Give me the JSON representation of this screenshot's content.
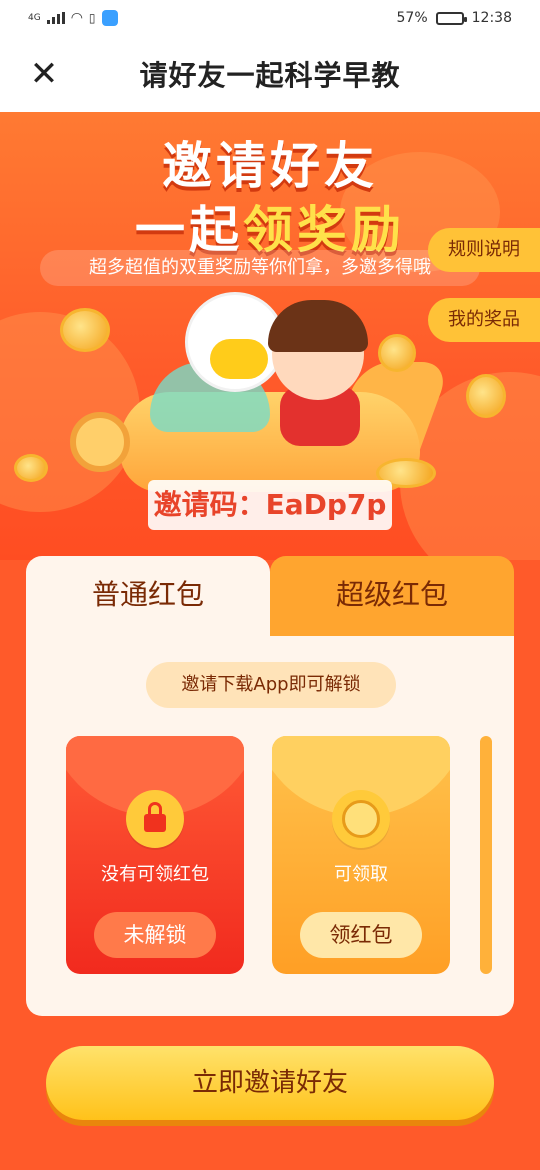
{
  "status_bar": {
    "network": "4G",
    "battery_percent": "57%",
    "battery_level": 0.57,
    "time": "12:38"
  },
  "header": {
    "close_icon": "close-icon",
    "title": "请好友一起科学早教"
  },
  "hero": {
    "title_line1": "邀请好友",
    "title_line2_prefix": "一起",
    "title_line2_highlight": "领奖励",
    "subtitle": "超多超值的双重奖励等你们拿，多邀多得哦",
    "rules_button": "规则说明",
    "prizes_button": "我的奖品",
    "invite_code_label": "邀请码：",
    "invite_code": "EaDp7p"
  },
  "red_packets": {
    "tabs": [
      {
        "label": "普通红包",
        "active": true
      },
      {
        "label": "超级红包",
        "active": false
      }
    ],
    "unlock_tip": "邀请下载App即可解锁",
    "cards": [
      {
        "label": "没有可领红包",
        "button": "未解锁",
        "icon": "lock-icon"
      },
      {
        "label": "可领取",
        "button": "领红包",
        "icon": "smiley-coin-icon"
      }
    ]
  },
  "cta": {
    "label": "立即邀请好友"
  },
  "colors": {
    "accent_red": "#ff5a2a",
    "gold": "#ffc21a",
    "text_brown": "#7a2a05"
  }
}
